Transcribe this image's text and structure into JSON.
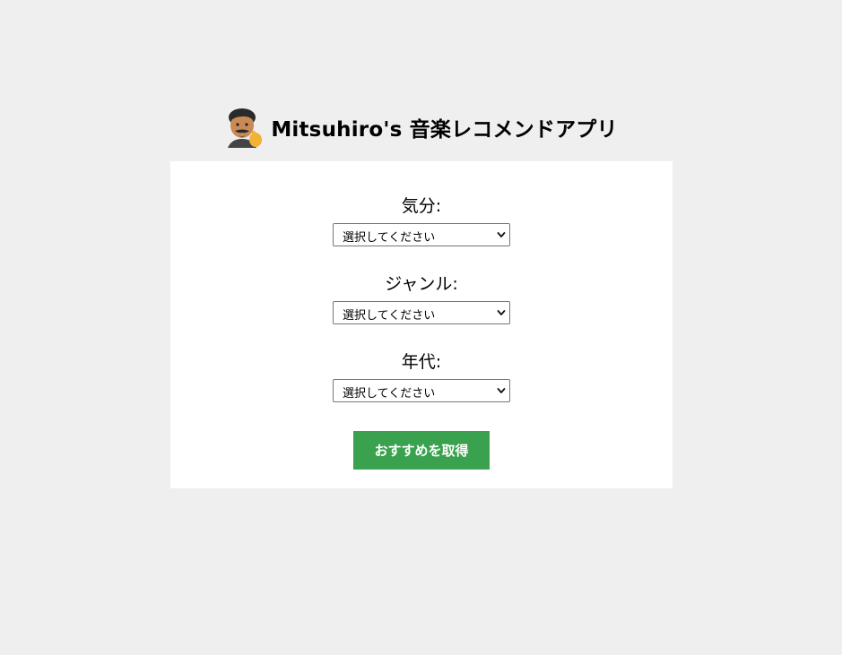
{
  "header": {
    "avatar_icon": "memoji-avatar-icon",
    "title": "Mitsuhiro's 音楽レコメンドアプリ"
  },
  "form": {
    "fields": [
      {
        "label": "気分:",
        "selected": "選択してください"
      },
      {
        "label": "ジャンル:",
        "selected": "選択してください"
      },
      {
        "label": "年代:",
        "selected": "選択してください"
      }
    ],
    "submit_label": "おすすめを取得"
  },
  "colors": {
    "page_background": "#efefef",
    "card_background": "#ffffff",
    "button_background": "#3aa24e",
    "button_text": "#ffffff"
  }
}
